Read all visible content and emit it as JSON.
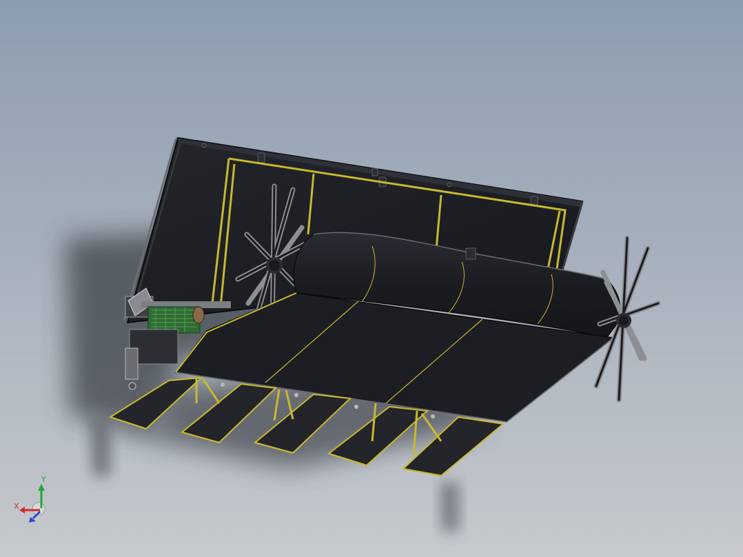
{
  "viewport": {
    "background_top": "#8c9db0",
    "background_bottom": "#c6c9cd",
    "model_colors": {
      "body": "#1b1c20",
      "frame": "#c9b92e",
      "steel": "#8a8c92",
      "mesh": "#3a7a3e"
    }
  },
  "triad": {
    "x_label": "X",
    "y_label": "Y",
    "x_color": "#d42a2a",
    "y_color": "#22a83a",
    "z_color": "#2a46d4"
  }
}
